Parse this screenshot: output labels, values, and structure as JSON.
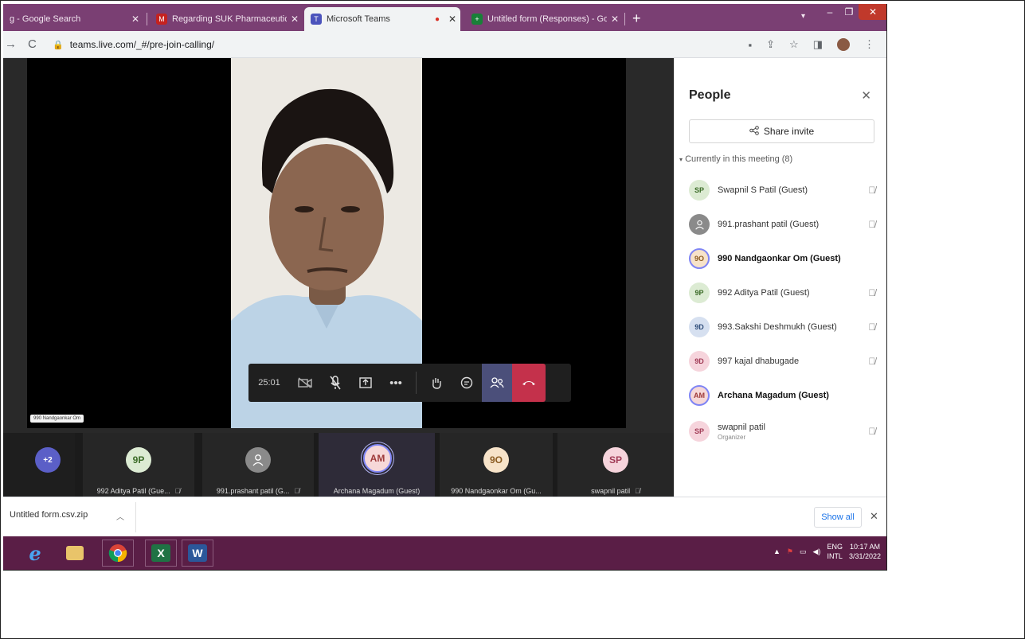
{
  "browser": {
    "tabs": [
      {
        "title": "g - Google Search",
        "favicon": "google-icon",
        "active": false
      },
      {
        "title": "Regarding SUK Pharmaceutics I",
        "favicon": "gmail-icon",
        "active": false
      },
      {
        "title": "Microsoft Teams",
        "favicon": "teams-icon",
        "active": true
      },
      {
        "title": "Untitled form (Responses) - Goo",
        "favicon": "sheets-icon",
        "active": false
      }
    ],
    "new_tab_label": "+",
    "url": "teams.live.com/_#/pre-join-calling/",
    "colors": {
      "tab_strip": "#7a3f73",
      "teams_purple": "#4b4f7a",
      "hangup_red": "#c4314b"
    }
  },
  "call": {
    "timer": "25:01",
    "active_speaker_tag": "990 Nandgaonkar Om"
  },
  "strip": {
    "overflow_badge": "+2",
    "tiles": [
      {
        "initials": "9P",
        "name": "992 Aditya Patil (Gue...",
        "muted": true
      },
      {
        "initials": "",
        "name": "991.prashant patil (G...",
        "muted": true
      },
      {
        "initials": "AM",
        "name": "Archana Magadum (Guest)",
        "muted": false
      },
      {
        "initials": "9O",
        "name": "990 Nandgaonkar Om (Gu...",
        "muted": false
      },
      {
        "initials": "SP",
        "name": "swapnil patil",
        "muted": true
      }
    ]
  },
  "people": {
    "title": "People",
    "share_invite": "Share invite",
    "section_label": "Currently in this meeting (8)",
    "participants": [
      {
        "initials": "SP",
        "name": "Swapnil S Patil (Guest)",
        "role": "",
        "muted": true,
        "bold": false
      },
      {
        "initials": "",
        "name": "991.prashant patil (Guest)",
        "role": "",
        "muted": true,
        "bold": false
      },
      {
        "initials": "9O",
        "name": "990 Nandgaonkar Om (Guest)",
        "role": "",
        "muted": false,
        "bold": true
      },
      {
        "initials": "9P",
        "name": "992 Aditya Patil (Guest)",
        "role": "",
        "muted": true,
        "bold": false
      },
      {
        "initials": "9D",
        "name": "993.Sakshi Deshmukh (Guest)",
        "role": "",
        "muted": true,
        "bold": false
      },
      {
        "initials": "9D",
        "name": "997 kajal dhabugade",
        "role": "",
        "muted": true,
        "bold": false
      },
      {
        "initials": "AM",
        "name": "Archana Magadum (Guest)",
        "role": "",
        "muted": false,
        "bold": true
      },
      {
        "initials": "SP",
        "name": "swapnil patil",
        "role": "Organizer",
        "muted": true,
        "bold": false
      }
    ]
  },
  "downloads": {
    "file": "Untitled form.csv.zip",
    "show_all": "Show all"
  },
  "taskbar": {
    "lang_top": "ENG",
    "lang_bottom": "INTL",
    "time": "10:17 AM",
    "date": "3/31/2022"
  }
}
